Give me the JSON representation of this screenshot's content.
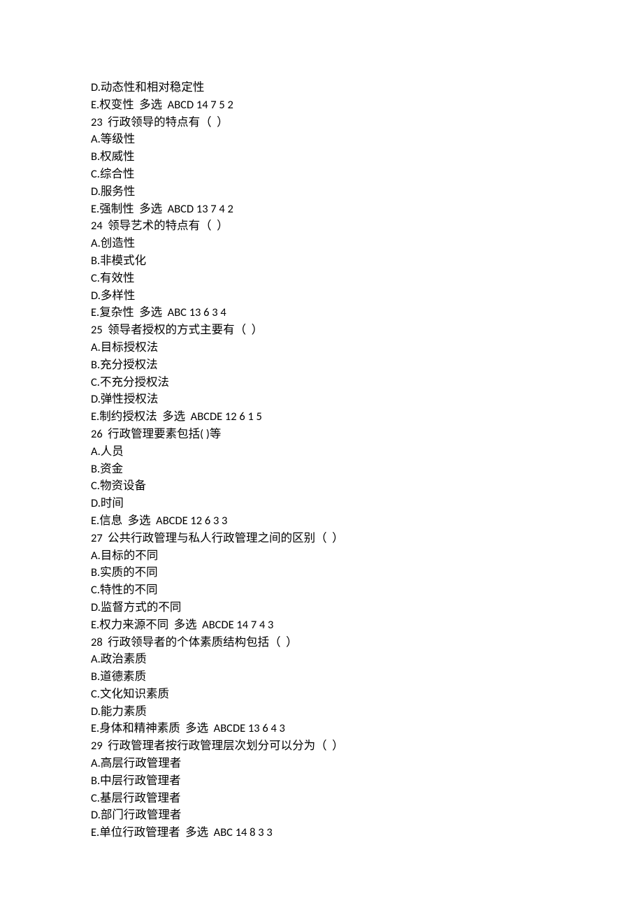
{
  "lines": [
    "D.动态性和相对稳定性",
    "E.权变性  多选  ABCD 14 7 5 2",
    "23  行政领导的特点有（  ）",
    "A.等级性",
    "B.权威性",
    "C.综合性",
    "D.服务性",
    "E.强制性  多选  ABCD 13 7 4 2",
    "24  领导艺术的特点有（  ）",
    "A.创造性",
    "B.非模式化",
    "C.有效性",
    "D.多样性",
    "E.复杂性  多选  ABC 13 6 3 4",
    "25  领导者授权的方式主要有（  ）",
    "A.目标授权法",
    "B.充分授权法",
    "C.不充分授权法",
    "D.弹性授权法",
    "E.制约授权法  多选  ABCDE 12 6 1 5",
    "26  行政管理要素包括( )等",
    "A.人员",
    "B.资金",
    "C.物资设备",
    "D.时间",
    "E.信息  多选  ABCDE 12 6 3 3",
    "27  公共行政管理与私人行政管理之间的区别（  ）",
    "A.目标的不同",
    "B.实质的不同",
    "C.特性的不同",
    "D.监督方式的不同",
    "E.权力来源不同  多选  ABCDE 14 7 4 3",
    "28  行政领导者的个体素质结构包括（  ）",
    "A.政治素质",
    "B.道德素质",
    "C.文化知识素质",
    "D.能力素质",
    "E.身体和精神素质  多选  ABCDE 13 6 4 3",
    "29  行政管理者按行政管理层次划分可以分为（  ）",
    "A.高层行政管理者",
    "B.中层行政管理者",
    "C.基层行政管理者",
    "D.部门行政管理者",
    "E.单位行政管理者  多选  ABC 14 8 3 3"
  ]
}
